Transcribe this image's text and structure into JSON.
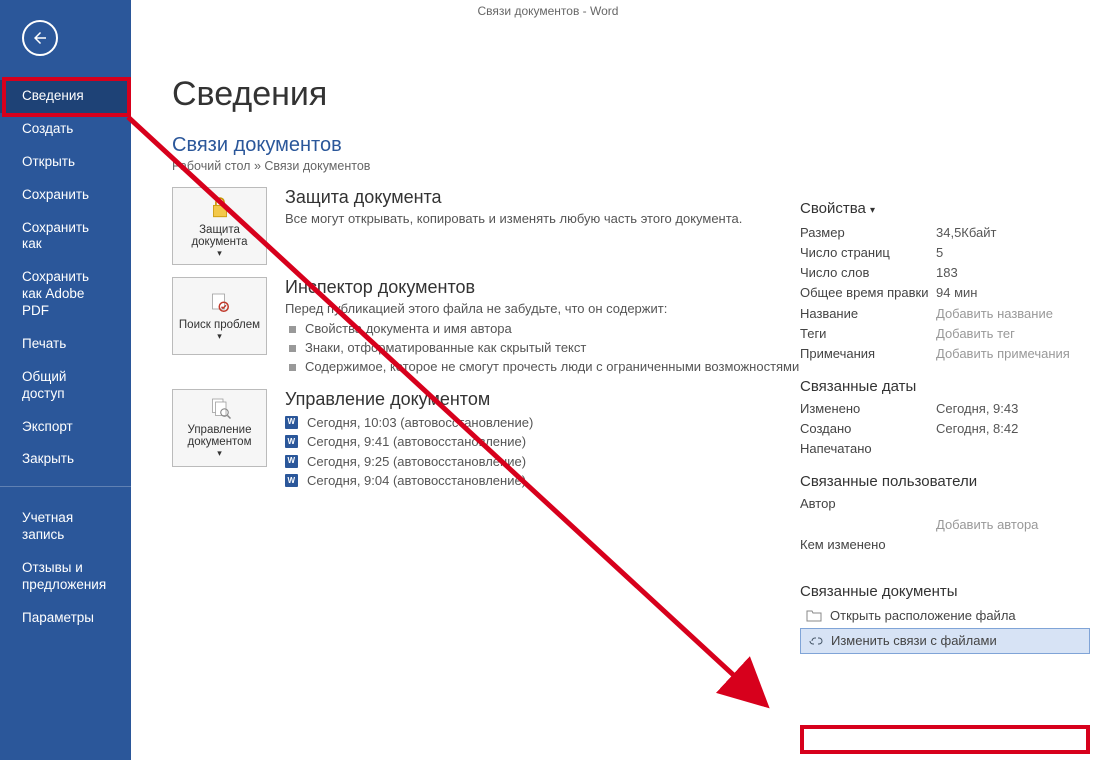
{
  "titlebar": "Связи документов  -  Word",
  "sidebar": {
    "items": [
      "Сведения",
      "Создать",
      "Открыть",
      "Сохранить",
      "Сохранить как",
      "Сохранить как Adobe PDF",
      "Печать",
      "Общий доступ",
      "Экспорт",
      "Закрыть"
    ],
    "lower": [
      "Учетная запись",
      "Отзывы и предложения",
      "Параметры"
    ]
  },
  "page": {
    "title": "Сведения",
    "doc_title": "Связи документов",
    "path": "Рабочий стол » Связи документов"
  },
  "tiles": {
    "protect": {
      "label": "Защита документа",
      "caret": "▾"
    },
    "inspect": {
      "label": "Поиск проблем",
      "caret": "▾"
    },
    "manage": {
      "label": "Управление документом",
      "caret": "▾"
    }
  },
  "protect": {
    "heading": "Защита документа",
    "text": "Все могут открывать, копировать и изменять любую часть этого документа."
  },
  "inspector": {
    "heading": "Инспектор документов",
    "text": "Перед публикацией этого файла не забудьте, что он содержит:",
    "bullets": [
      "Свойства документа и имя автора",
      "Знаки, отформатированные как скрытый текст",
      "Содержимое, которое не смогут прочесть люди с ограниченными возможностями"
    ]
  },
  "manage": {
    "heading": "Управление документом",
    "items": [
      "Сегодня, 10:03 (автовосстановление)",
      "Сегодня, 9:41 (автовосстановление)",
      "Сегодня, 9:25 (автовосстановление)",
      "Сегодня, 9:04 (автовосстановление)"
    ]
  },
  "props": {
    "heading": "Свойства",
    "rows": [
      {
        "k": "Размер",
        "v": "34,5Кбайт"
      },
      {
        "k": "Число страниц",
        "v": "5"
      },
      {
        "k": "Число слов",
        "v": "183"
      },
      {
        "k": "Общее время правки",
        "v": "94 мин"
      },
      {
        "k": "Название",
        "v": "Добавить название",
        "ph": true
      },
      {
        "k": "Теги",
        "v": "Добавить тег",
        "ph": true
      },
      {
        "k": "Примечания",
        "v": "Добавить примечания",
        "ph": true
      }
    ]
  },
  "dates": {
    "heading": "Связанные даты",
    "rows": [
      {
        "k": "Изменено",
        "v": "Сегодня, 9:43"
      },
      {
        "k": "Создано",
        "v": "Сегодня, 8:42"
      },
      {
        "k": "Напечатано",
        "v": ""
      }
    ]
  },
  "users": {
    "heading": "Связанные пользователи",
    "author_label": "Автор",
    "add_author": "Добавить автора",
    "modified_by_label": "Кем изменено"
  },
  "docs": {
    "heading": "Связанные документы",
    "open_loc": "Открыть расположение файла",
    "edit_links": "Изменить связи с файлами"
  }
}
